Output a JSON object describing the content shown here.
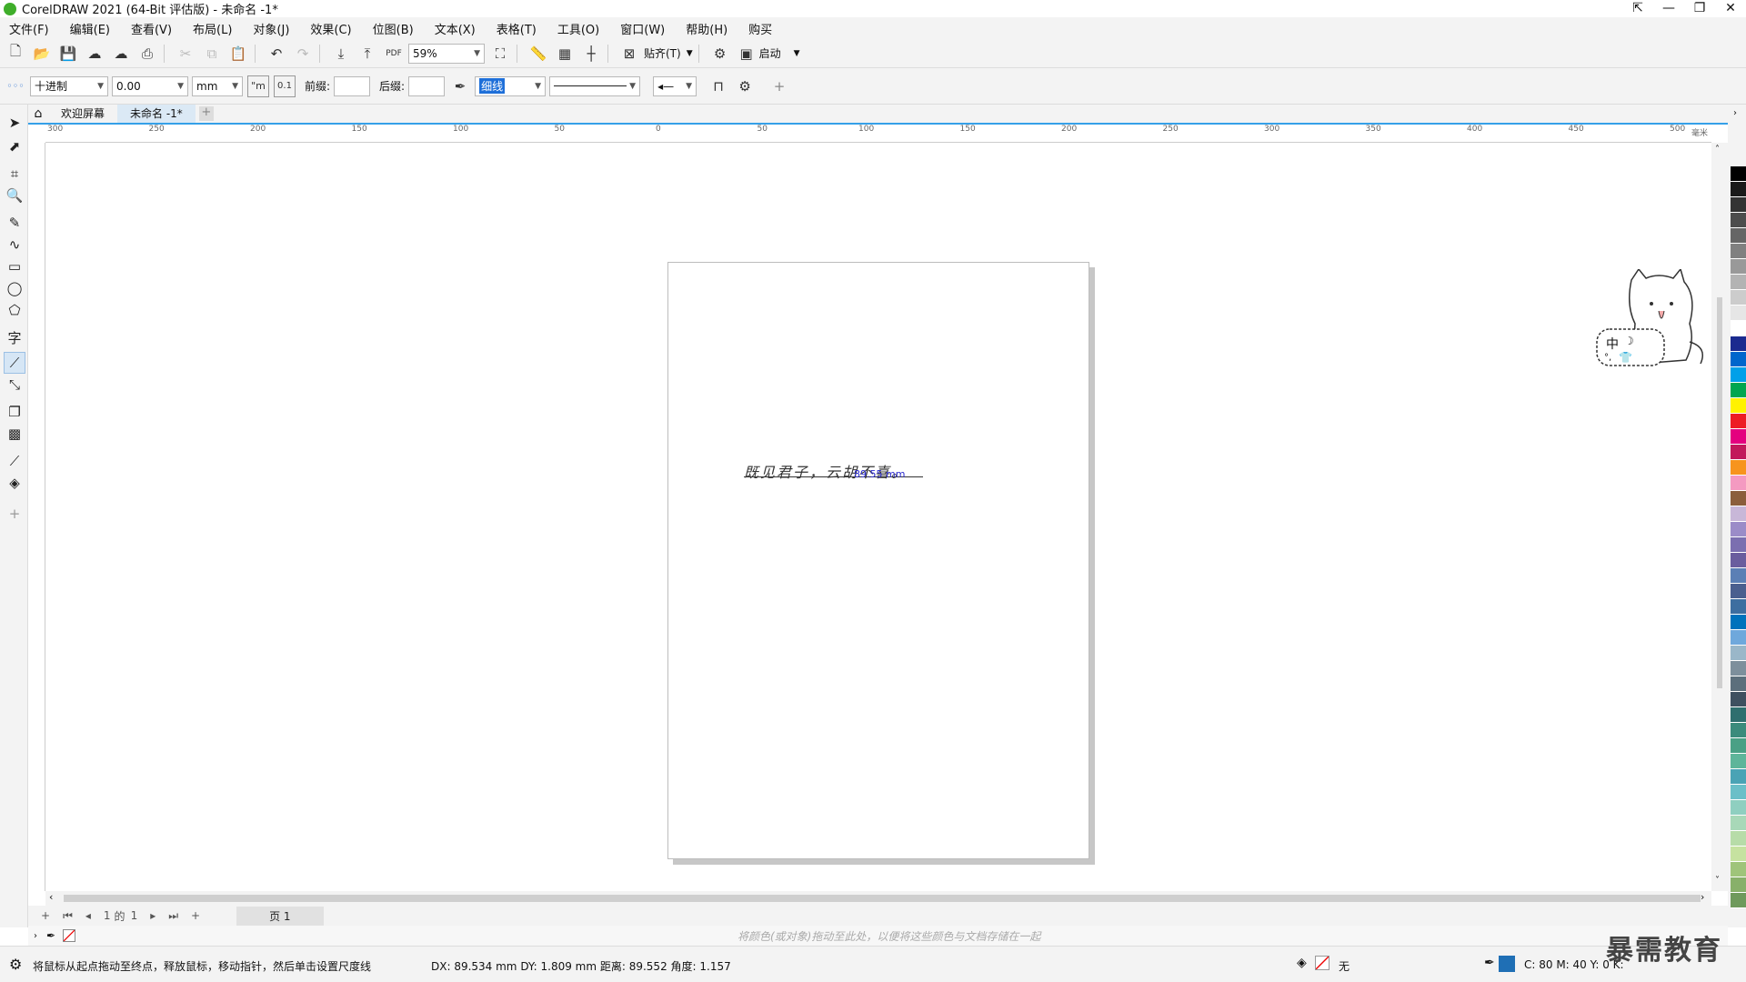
{
  "window": {
    "title": "CorelDRAW 2021 (64-Bit 评估版) - 未命名 -1*"
  },
  "menu": [
    "文件(F)",
    "编辑(E)",
    "查看(V)",
    "布局(L)",
    "对象(J)",
    "效果(C)",
    "位图(B)",
    "文本(X)",
    "表格(T)",
    "工具(O)",
    "窗口(W)",
    "帮助(H)",
    "购买"
  ],
  "toolbar1": {
    "zoom": "59%",
    "snap_label": "贴齐(T)",
    "launch_label": "启动"
  },
  "propertybar": {
    "unit_style": "十进制",
    "precision": "0.00",
    "units": "mm",
    "prefix_label": "前缀:",
    "suffix_label": "后缀:",
    "outline_width": "细线"
  },
  "tabs": [
    {
      "label": "欢迎屏幕"
    },
    {
      "label": "未命名 -1*"
    }
  ],
  "ruler": {
    "h_labels": [
      "300",
      "250",
      "200",
      "150",
      "100",
      "50",
      "0",
      "50",
      "100",
      "150",
      "200",
      "250",
      "300",
      "350",
      "400",
      "450",
      "500"
    ],
    "unit": "毫米"
  },
  "canvas": {
    "text": "既见君子，云胡不喜。",
    "dimension_label": "89.55 mm",
    "mascot_text": "中"
  },
  "pagenav": {
    "current": "1",
    "of_label": "的",
    "total": "1",
    "page_tab": "页 1"
  },
  "hintbar": {
    "hint": "将颜色(或对象)拖动至此处，以便将这些颜色与文档存储在一起"
  },
  "status": {
    "message": "将鼠标从起点拖动至终点，释放鼠标，移动指针，然后单击设置尺度线",
    "measure": "DX:  89.534 mm DY:  1.809 mm 距离:  89.552 角度:  1.157",
    "fill_label": "无",
    "color_readout": "C:  80 M:  40 Y:  0 K:"
  },
  "watermark": "暴需教育",
  "palette": [
    "#000000",
    "#1a1a1a",
    "#333333",
    "#4d4d4d",
    "#666666",
    "#808080",
    "#999999",
    "#b3b3b3",
    "#cccccc",
    "#e6e6e6",
    "#ffffff",
    "#1b2a8f",
    "#0066cc",
    "#00a0e9",
    "#00a650",
    "#fff200",
    "#ed1c24",
    "#e4007f",
    "#c2185b",
    "#f7941d",
    "#f49ac1",
    "#8b5e3c",
    "#c8b7d8",
    "#9b8cc8",
    "#7b6fb0",
    "#6a5d9e",
    "#5b7fb5",
    "#4a5f8f",
    "#3d6ea0",
    "#0072bc",
    "#6fa8dc",
    "#9ab7c9",
    "#7d8f9c",
    "#5c6f7c",
    "#3e5060",
    "#2f6f6f",
    "#3b8b7c",
    "#4aa085",
    "#5eb59a",
    "#4aa3b5",
    "#6bbfc8",
    "#8fcfc0",
    "#a8d8b8",
    "#b7dca8",
    "#c6e2a0",
    "#9fc47a",
    "#88b06a",
    "#6f9a5c"
  ]
}
